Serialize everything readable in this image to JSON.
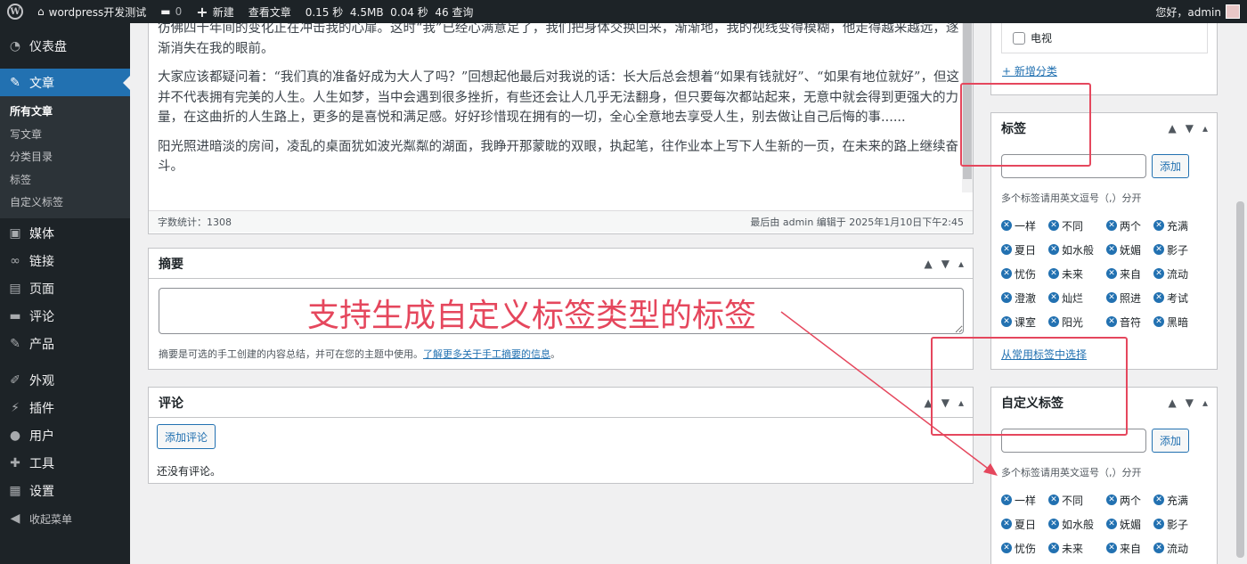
{
  "adminbar": {
    "site_name": "wordpress开发测试",
    "comments_count": "0",
    "new_label": "新建",
    "view_label": "查看文章",
    "stats": "0.15 秒  4.5MB  0.04 秒  46 查询",
    "greeting": "您好，admin"
  },
  "sidebar": {
    "items": [
      {
        "icon": "dashboard-icon",
        "label": "仪表盘"
      },
      {
        "icon": "pin-icon",
        "label": "文章"
      },
      {
        "icon": "media-icon",
        "label": "媒体"
      },
      {
        "icon": "link-icon",
        "label": "链接"
      },
      {
        "icon": "page-icon",
        "label": "页面"
      },
      {
        "icon": "comment-icon",
        "label": "评论"
      },
      {
        "icon": "product-icon",
        "label": "产品"
      },
      {
        "icon": "appearance-icon",
        "label": "外观"
      },
      {
        "icon": "plugin-icon",
        "label": "插件"
      },
      {
        "icon": "user-icon",
        "label": "用户"
      },
      {
        "icon": "tool-icon",
        "label": "工具"
      },
      {
        "icon": "settings-icon",
        "label": "设置"
      },
      {
        "icon": "collapse-icon",
        "label": "收起菜单"
      }
    ],
    "submenu": [
      "所有文章",
      "写文章",
      "分类目录",
      "标签",
      "自定义标签"
    ]
  },
  "editor": {
    "paragraphs": [
      "彷佛四十年间的变化正在冲击我的心扉。这时“我”已经心满意足了，我们把身体交换回来，渐渐地，我的视线变得模糊，他走得越来越远，逐渐消失在我的眼前。",
      "大家应该都疑问着：“我们真的准备好成为大人了吗？”回想起他最后对我说的话：长大后总会想着“如果有钱就好”、“如果有地位就好”，但这并不代表拥有完美的人生。人生如梦，当中会遇到很多挫折，有些还会让人几乎无法翻身，但只要每次都站起来，无意中就会得到更强大的力量，在这曲折的人生路上，更多的是喜悦和满足感。好好珍惜现在拥有的一切，全心全意地去享受人生，别去做让自己后悔的事......",
      "阳光照进暗淡的房间，凌乱的桌面犹如波光粼粼的湖面，我睁开那蒙眬的双眼，执起笔，往作业本上写下人生新的一页，在未来的路上继续奋斗。"
    ],
    "word_count": "字数统计：1308",
    "last_edited": "最后由 admin 编辑于 2025年1月10日下午2:45"
  },
  "excerpt": {
    "title": "摘要",
    "help_text": "摘要是可选的手工创建的内容总结，并可在您的主题中使用。",
    "help_link": "了解更多关于手工摘要的信息",
    "help_end": "。"
  },
  "comments": {
    "title": "评论",
    "add_button": "添加评论",
    "empty_text": "还没有评论。"
  },
  "categories": {
    "checkbox_label": "电视",
    "add_link": "+ 新增分类"
  },
  "tags_box": {
    "title": "标签",
    "add_button": "添加",
    "hint": "多个标签请用英文逗号（,）分开",
    "tags": [
      "一样",
      "不同",
      "两个",
      "充满",
      "夏日",
      "如水般",
      "妩媚",
      "影子",
      "忧伤",
      "未来",
      "来自",
      "流动",
      "澄澈",
      "灿烂",
      "照进",
      "考试",
      "课室",
      "阳光",
      "音符",
      "黑暗"
    ],
    "choose_link": "从常用标签中选择"
  },
  "custom_tags_box": {
    "title": "自定义标签",
    "add_button": "添加",
    "hint": "多个标签请用英文逗号（,）分开",
    "tags": [
      "一样",
      "不同",
      "两个",
      "充满",
      "夏日",
      "如水般",
      "妩媚",
      "影子",
      "忧伤",
      "未来",
      "来自",
      "流动"
    ]
  },
  "annotation": "支持生成自定义标签类型的标签",
  "colors": {
    "accent": "#2271b1",
    "admin_dark": "#1d2327",
    "annotation_red": "#e5475d"
  }
}
